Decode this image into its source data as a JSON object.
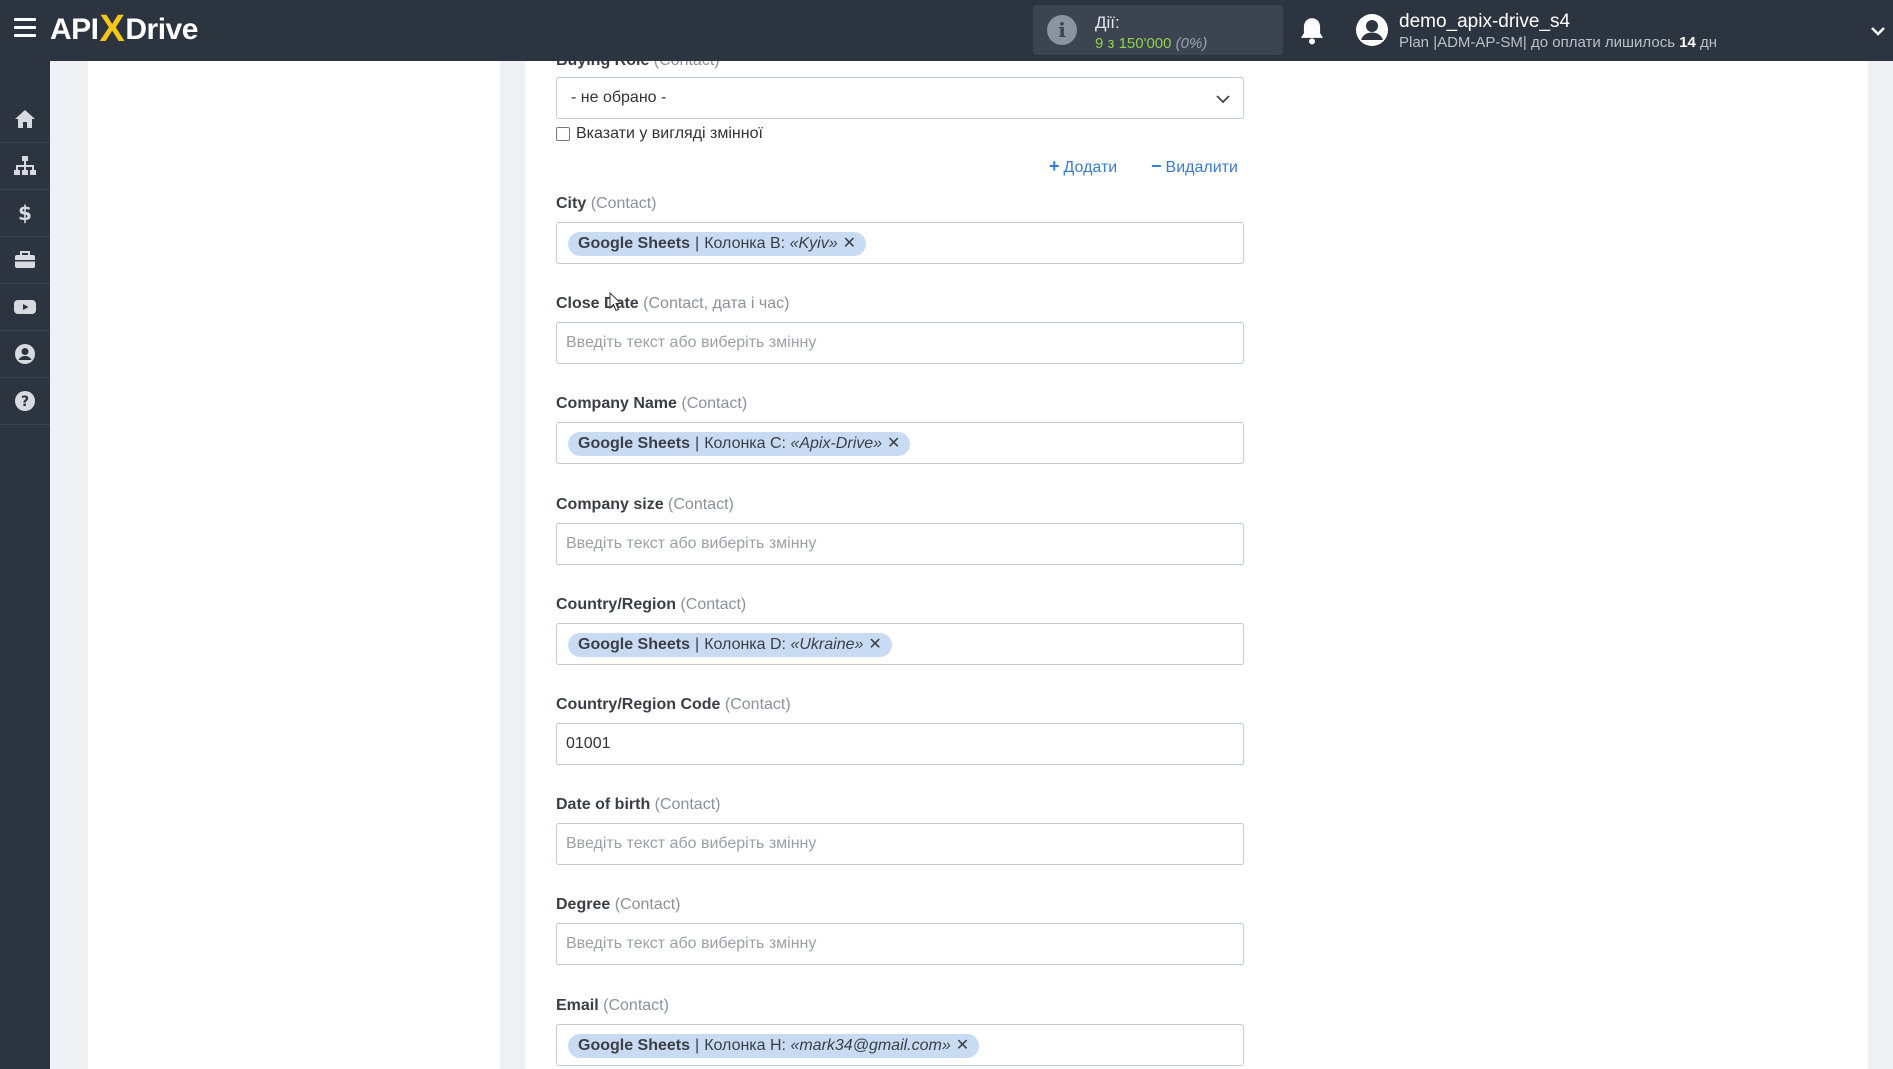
{
  "app": {
    "logo_left": "API",
    "logo_x": "X",
    "logo_right": "Drive"
  },
  "topbar": {
    "actions_label": "Дії:",
    "actions_used": "9",
    "actions_of": "з",
    "actions_total": "150'000",
    "actions_pct": "(0%)",
    "user_name": "demo_apix-drive_s4",
    "plan_text": "Plan |ADM-AP-SM| до оплати лишилось",
    "plan_days": "14",
    "plan_days_unit": "дн",
    "icons": [
      "menu-icon",
      "info-icon",
      "bell-icon",
      "user-avatar-icon",
      "chevron-down-icon"
    ]
  },
  "sidebar": {
    "items": [
      {
        "icon": "home-icon"
      },
      {
        "icon": "sitemap-icon"
      },
      {
        "icon": "dollar-icon"
      },
      {
        "icon": "briefcase-icon"
      },
      {
        "icon": "youtube-icon"
      },
      {
        "icon": "user-circle-icon"
      },
      {
        "icon": "question-icon"
      }
    ]
  },
  "form": {
    "buying_role": {
      "label": "Buying Role",
      "hint": "(Contact)",
      "selected": "- не обрано -"
    },
    "as_variable_label": "Вказати у вигляді змінної",
    "add_label": "Додати",
    "remove_label": "Видалити",
    "placeholder": "Введіть текст або виберіть змінну",
    "fields": {
      "city": {
        "label": "City",
        "hint": "(Contact)",
        "chip_source": "Google Sheets",
        "chip_col": "Колонка B:",
        "chip_value": "«Kyiv»"
      },
      "close_date": {
        "label": "Close Date",
        "hint": "(Contact, дата і час)"
      },
      "company_name": {
        "label": "Company Name",
        "hint": "(Contact)",
        "chip_source": "Google Sheets",
        "chip_col": "Колонка C:",
        "chip_value": "«Apix-Drive»"
      },
      "company_size": {
        "label": "Company size",
        "hint": "(Contact)"
      },
      "country_region": {
        "label": "Country/Region",
        "hint": "(Contact)",
        "chip_source": "Google Sheets",
        "chip_col": "Колонка D:",
        "chip_value": "«Ukraine»"
      },
      "country_region_code": {
        "label": "Country/Region Code",
        "hint": "(Contact)",
        "value": "01001"
      },
      "date_of_birth": {
        "label": "Date of birth",
        "hint": "(Contact)"
      },
      "degree": {
        "label": "Degree",
        "hint": "(Contact)"
      },
      "email": {
        "label": "Email",
        "hint": "(Contact)",
        "chip_source": "Google Sheets",
        "chip_col": "Колонка H:",
        "chip_value": "«mark34@gmail.com»"
      }
    }
  },
  "colors": {
    "topbar_bg": "#2c3440",
    "accent_yellow": "#f5c518",
    "chip_bg": "#c9dbf3",
    "link_blue": "#3a7bd5",
    "actions_green": "#8fd14f"
  }
}
